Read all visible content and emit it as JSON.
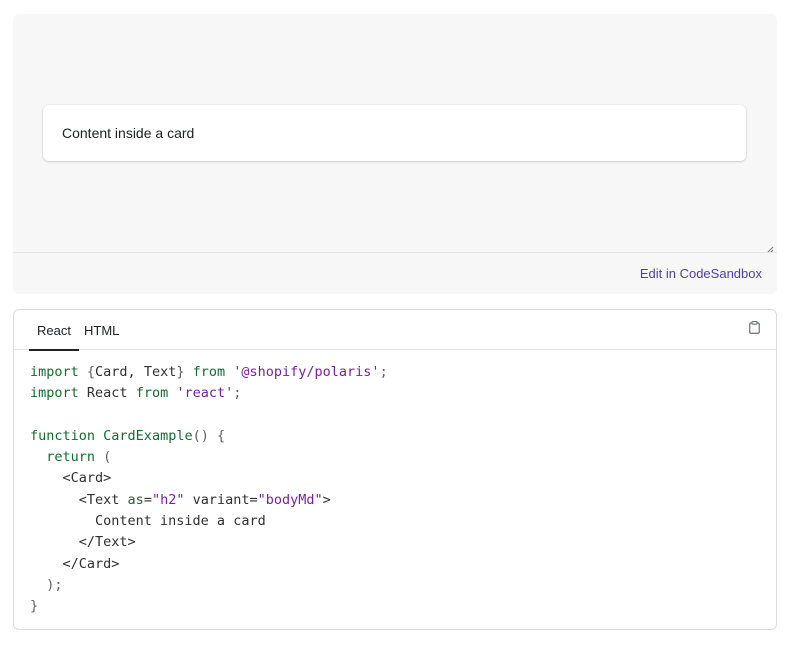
{
  "preview": {
    "card_text": "Content inside a card",
    "edit_link": "Edit in CodeSandbox"
  },
  "code_panel": {
    "tabs": [
      {
        "label": "React",
        "active": true
      },
      {
        "label": "HTML",
        "active": false
      }
    ],
    "copy_icon": "clipboard-icon",
    "lines": [
      [
        {
          "t": "kw",
          "v": "import"
        },
        {
          "t": "pun",
          "v": " {"
        },
        {
          "t": "txt",
          "v": "Card, Text"
        },
        {
          "t": "pun",
          "v": "} "
        },
        {
          "t": "kw",
          "v": "from"
        },
        {
          "t": "txt",
          "v": " "
        },
        {
          "t": "str",
          "v": "'@shopify/polaris'"
        },
        {
          "t": "pun",
          "v": ";"
        }
      ],
      [
        {
          "t": "kw",
          "v": "import"
        },
        {
          "t": "txt",
          "v": " React "
        },
        {
          "t": "kw",
          "v": "from"
        },
        {
          "t": "txt",
          "v": " "
        },
        {
          "t": "str",
          "v": "'react'"
        },
        {
          "t": "pun",
          "v": ";"
        }
      ],
      [],
      [
        {
          "t": "kw",
          "v": "function"
        },
        {
          "t": "txt",
          "v": " "
        },
        {
          "t": "kw",
          "v": "CardExample"
        },
        {
          "t": "pun",
          "v": "() {"
        }
      ],
      [
        {
          "t": "txt",
          "v": "  "
        },
        {
          "t": "kw",
          "v": "return"
        },
        {
          "t": "pun",
          "v": " ("
        }
      ],
      [
        {
          "t": "txt",
          "v": "    <Card>"
        }
      ],
      [
        {
          "t": "txt",
          "v": "      <Text "
        },
        {
          "t": "attr",
          "v": "as"
        },
        {
          "t": "txt",
          "v": "="
        },
        {
          "t": "str",
          "v": "\"h2\""
        },
        {
          "t": "txt",
          "v": " variant="
        },
        {
          "t": "str",
          "v": "\"bodyMd\""
        },
        {
          "t": "txt",
          "v": ">"
        }
      ],
      [
        {
          "t": "txt",
          "v": "        Content inside a card"
        }
      ],
      [
        {
          "t": "txt",
          "v": "      </Text>"
        }
      ],
      [
        {
          "t": "txt",
          "v": "    </Card>"
        }
      ],
      [
        {
          "t": "txt",
          "v": "  "
        },
        {
          "t": "pun",
          "v": ");"
        }
      ],
      [
        {
          "t": "pun",
          "v": "}"
        }
      ]
    ]
  },
  "colors": {
    "preview_bg": "#f7f7f7",
    "link": "#4f3ea5",
    "keyword": "#146c2e",
    "string": "#7b1fa2"
  }
}
